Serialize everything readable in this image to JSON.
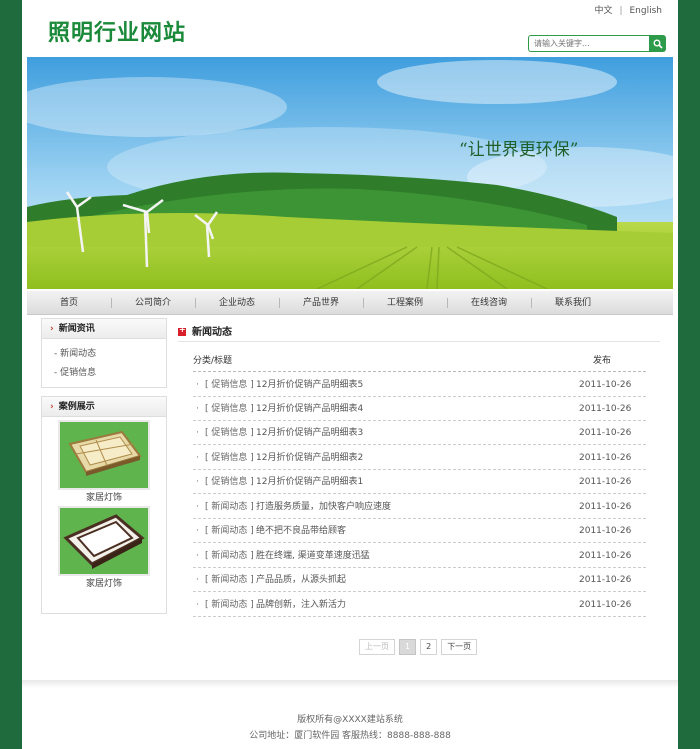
{
  "site": {
    "logo": "照明行业网站"
  },
  "lang": {
    "zh": "中文",
    "sep": "|",
    "en": "English"
  },
  "search": {
    "placeholder": "请输入关键字..."
  },
  "banner": {
    "slogan": "“让世界更环保”"
  },
  "nav": {
    "items": [
      "首页",
      "公司简介",
      "企业动态",
      "产品世界",
      "工程案例",
      "在线咨询",
      "联系我们"
    ]
  },
  "sidebar": {
    "news_title": "新闻资讯",
    "news_links": [
      "新闻动态",
      "促销信息"
    ],
    "cases_title": "案例展示",
    "cases": [
      {
        "label": "家居灯饰"
      },
      {
        "label": "家居灯饰"
      }
    ]
  },
  "main": {
    "title": "新闻动态",
    "col_title": "分类/标题",
    "col_date": "发布",
    "rows": [
      {
        "cat": "[ 促销信息 ]",
        "title": "12月折价促销产品明细表5",
        "date": "2011-10-26"
      },
      {
        "cat": "[ 促销信息 ]",
        "title": "12月折价促销产品明细表4",
        "date": "2011-10-26"
      },
      {
        "cat": "[ 促销信息 ]",
        "title": "12月折价促销产品明细表3",
        "date": "2011-10-26"
      },
      {
        "cat": "[ 促销信息 ]",
        "title": "12月折价促销产品明细表2",
        "date": "2011-10-26"
      },
      {
        "cat": "[ 促销信息 ]",
        "title": "12月折价促销产品明细表1",
        "date": "2011-10-26"
      },
      {
        "cat": "[ 新闻动态 ]",
        "title": "打造服务质量，加快客户响应速度",
        "date": "2011-10-26"
      },
      {
        "cat": "[ 新闻动态 ]",
        "title": "绝不把不良品带给顾客",
        "date": "2011-10-26"
      },
      {
        "cat": "[ 新闻动态 ]",
        "title": "胜在终端, 渠道变革速度迅猛",
        "date": "2011-10-26"
      },
      {
        "cat": "[ 新闻动态 ]",
        "title": "产品品质，从源头抓起",
        "date": "2011-10-26"
      },
      {
        "cat": "[ 新闻动态 ]",
        "title": "品牌创新，注入新活力",
        "date": "2011-10-26"
      }
    ]
  },
  "pager": {
    "prev": "上一页",
    "pages": [
      "1",
      "2"
    ],
    "next": "下一页"
  },
  "footer": {
    "copyright": "版权所有@XXXX建站系统",
    "address": "公司地址：厦门软件园   客服热线：8888-888-888"
  },
  "colors": {
    "brand_green": "#1a8a3a",
    "frame_green": "#1f6b3d",
    "accent_red": "#d9202a"
  }
}
